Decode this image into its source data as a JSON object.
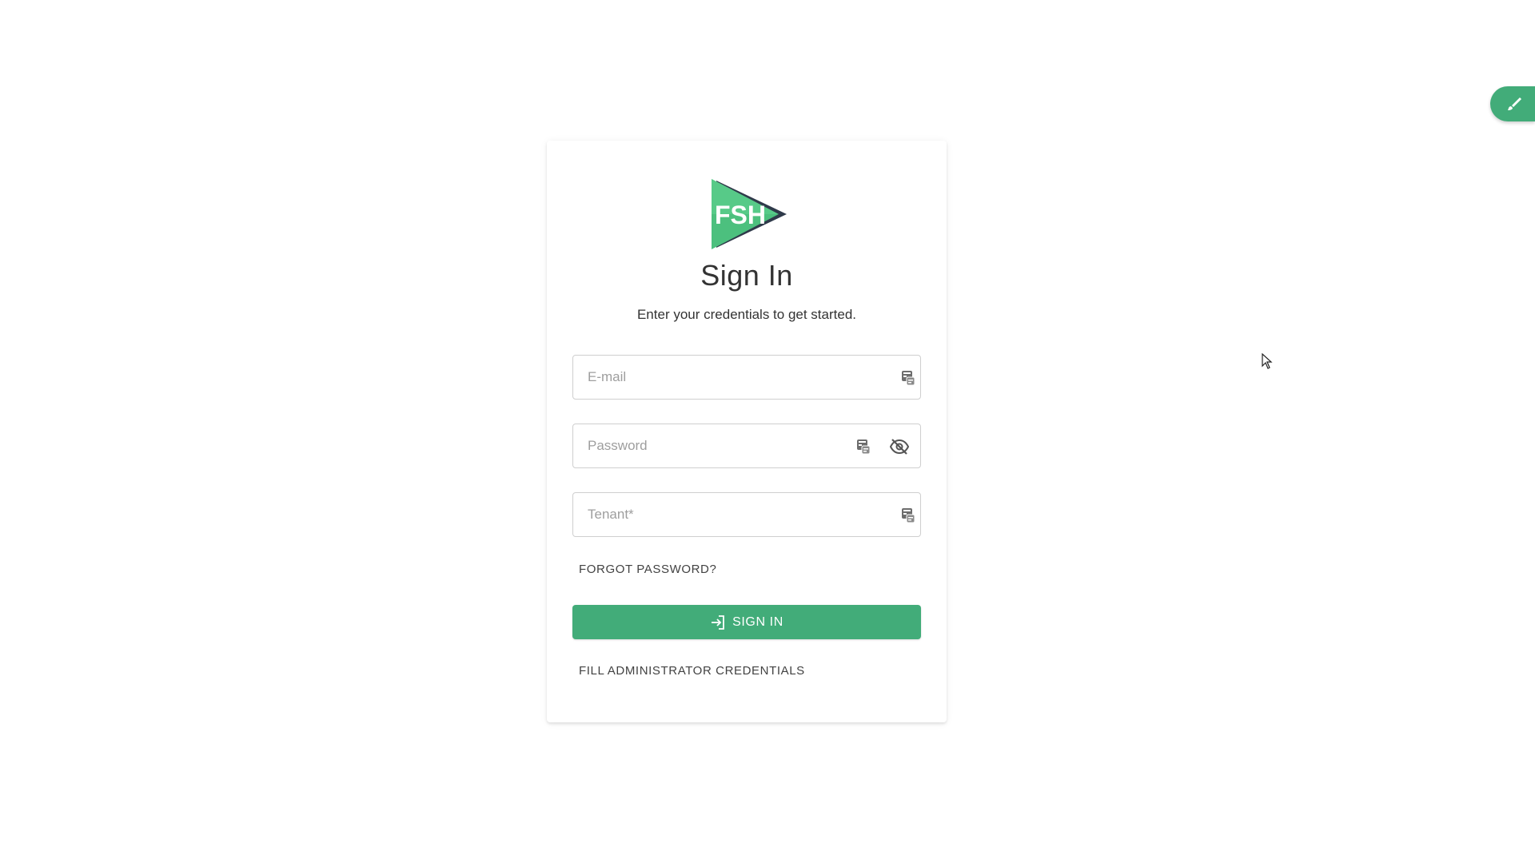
{
  "login": {
    "title": "Sign In",
    "subtitle": "Enter your credentials to get started.",
    "email": {
      "placeholder": "E-mail",
      "value": ""
    },
    "password": {
      "placeholder": "Password",
      "value": ""
    },
    "tenant": {
      "placeholder": "Tenant*",
      "value": ""
    },
    "forgot_password": "FORGOT PASSWORD?",
    "sign_in_label": "SIGN IN",
    "fill_admin_label": "FILL ADMINISTRATOR CREDENTIALS",
    "logo_text": "FSH"
  },
  "icons": {
    "logo": "fsh-logo",
    "autofill": "password-manager-icon",
    "visibility": "visibility-off-icon",
    "sign_in": "login-icon",
    "theme": "brush-icon"
  },
  "colors": {
    "primary": "#42ac79",
    "logo_green": "#4cc07e",
    "logo_dark": "#2f3a4a",
    "field_border": "#cfcfcf",
    "text": "#333333",
    "placeholder": "#9e9e9e"
  }
}
